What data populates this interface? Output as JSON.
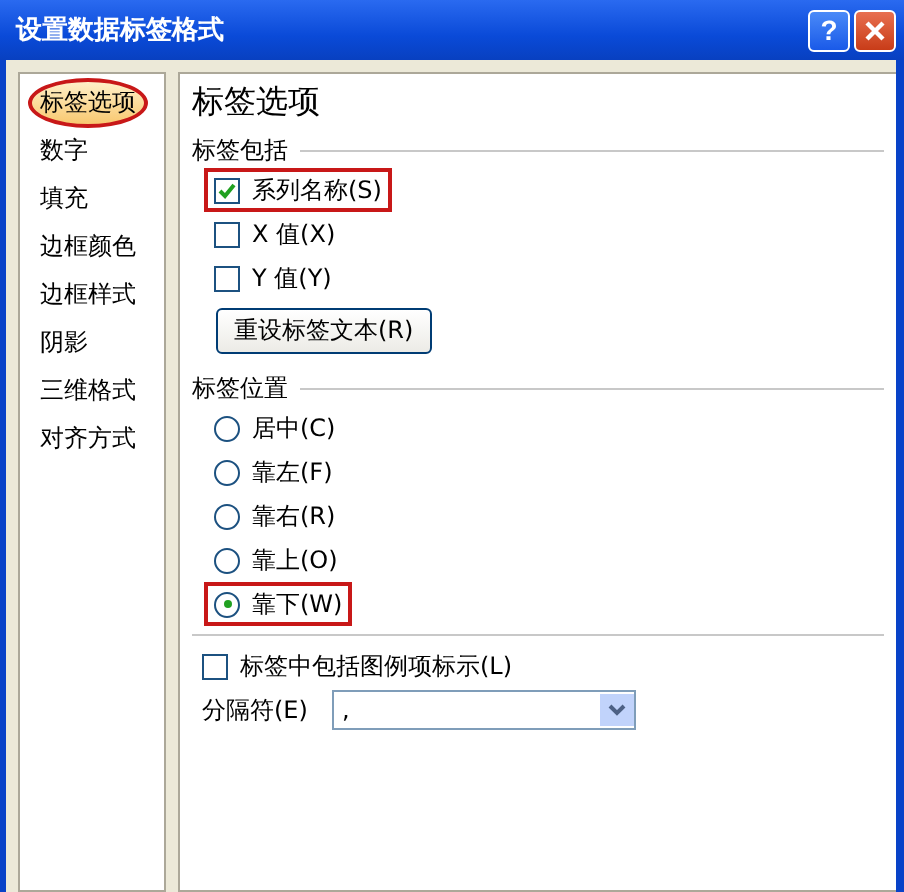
{
  "window": {
    "title": "设置数据标签格式",
    "buttons": [
      {
        "kind": "help",
        "label": "?"
      },
      {
        "kind": "close"
      }
    ]
  },
  "sidebar": {
    "items": [
      {
        "label": "标签选项",
        "selected": true,
        "highlighted": true
      },
      {
        "label": "数字",
        "selected": false,
        "highlighted": false
      },
      {
        "label": "填充",
        "selected": false,
        "highlighted": false
      },
      {
        "label": "边框颜色",
        "selected": false,
        "highlighted": false
      },
      {
        "label": "边框样式",
        "selected": false,
        "highlighted": false
      },
      {
        "label": "阴影",
        "selected": false,
        "highlighted": false
      },
      {
        "label": "三维格式",
        "selected": false,
        "highlighted": false
      },
      {
        "label": "对齐方式",
        "selected": false,
        "highlighted": false
      }
    ]
  },
  "panel": {
    "heading": "标签选项",
    "label_contains": {
      "title": "标签包括",
      "options": [
        {
          "label": "系列名称(S)",
          "checked": true,
          "highlighted": true
        },
        {
          "label": "X 值(X)",
          "checked": false,
          "highlighted": false
        },
        {
          "label": "Y 值(Y)",
          "checked": false,
          "highlighted": false
        }
      ],
      "reset_button": "重设标签文本(R)"
    },
    "label_position": {
      "title": "标签位置",
      "options": [
        {
          "label": "居中(C)",
          "selected": false,
          "highlighted": false
        },
        {
          "label": "靠左(F)",
          "selected": false,
          "highlighted": false
        },
        {
          "label": "靠右(R)",
          "selected": false,
          "highlighted": false
        },
        {
          "label": "靠上(O)",
          "selected": false,
          "highlighted": false
        },
        {
          "label": "靠下(W)",
          "selected": true,
          "highlighted": true
        }
      ]
    },
    "legend_key": {
      "label": "标签中包括图例项标示(L)",
      "checked": false
    },
    "separator": {
      "label": "分隔符(E)",
      "value": ","
    }
  }
}
